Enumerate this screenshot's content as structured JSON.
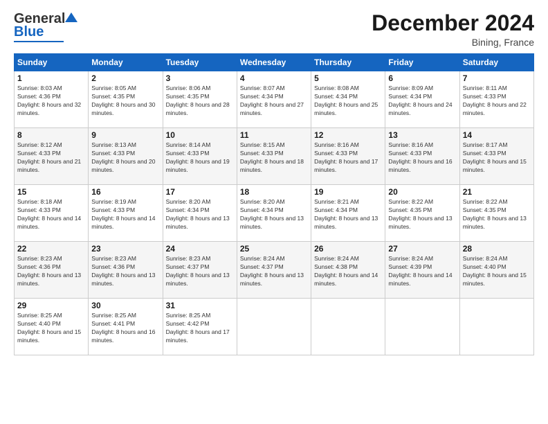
{
  "header": {
    "logo_general": "General",
    "logo_blue": "Blue",
    "title": "December 2024",
    "subtitle": "Bining, France"
  },
  "weekdays": [
    "Sunday",
    "Monday",
    "Tuesday",
    "Wednesday",
    "Thursday",
    "Friday",
    "Saturday"
  ],
  "weeks": [
    [
      {
        "day": "1",
        "sunrise": "8:03 AM",
        "sunset": "4:36 PM",
        "daylight": "8 hours and 32 minutes."
      },
      {
        "day": "2",
        "sunrise": "8:05 AM",
        "sunset": "4:35 PM",
        "daylight": "8 hours and 30 minutes."
      },
      {
        "day": "3",
        "sunrise": "8:06 AM",
        "sunset": "4:35 PM",
        "daylight": "8 hours and 28 minutes."
      },
      {
        "day": "4",
        "sunrise": "8:07 AM",
        "sunset": "4:34 PM",
        "daylight": "8 hours and 27 minutes."
      },
      {
        "day": "5",
        "sunrise": "8:08 AM",
        "sunset": "4:34 PM",
        "daylight": "8 hours and 25 minutes."
      },
      {
        "day": "6",
        "sunrise": "8:09 AM",
        "sunset": "4:34 PM",
        "daylight": "8 hours and 24 minutes."
      },
      {
        "day": "7",
        "sunrise": "8:11 AM",
        "sunset": "4:33 PM",
        "daylight": "8 hours and 22 minutes."
      }
    ],
    [
      {
        "day": "8",
        "sunrise": "8:12 AM",
        "sunset": "4:33 PM",
        "daylight": "8 hours and 21 minutes."
      },
      {
        "day": "9",
        "sunrise": "8:13 AM",
        "sunset": "4:33 PM",
        "daylight": "8 hours and 20 minutes."
      },
      {
        "day": "10",
        "sunrise": "8:14 AM",
        "sunset": "4:33 PM",
        "daylight": "8 hours and 19 minutes."
      },
      {
        "day": "11",
        "sunrise": "8:15 AM",
        "sunset": "4:33 PM",
        "daylight": "8 hours and 18 minutes."
      },
      {
        "day": "12",
        "sunrise": "8:16 AM",
        "sunset": "4:33 PM",
        "daylight": "8 hours and 17 minutes."
      },
      {
        "day": "13",
        "sunrise": "8:16 AM",
        "sunset": "4:33 PM",
        "daylight": "8 hours and 16 minutes."
      },
      {
        "day": "14",
        "sunrise": "8:17 AM",
        "sunset": "4:33 PM",
        "daylight": "8 hours and 15 minutes."
      }
    ],
    [
      {
        "day": "15",
        "sunrise": "8:18 AM",
        "sunset": "4:33 PM",
        "daylight": "8 hours and 14 minutes."
      },
      {
        "day": "16",
        "sunrise": "8:19 AM",
        "sunset": "4:33 PM",
        "daylight": "8 hours and 14 minutes."
      },
      {
        "day": "17",
        "sunrise": "8:20 AM",
        "sunset": "4:34 PM",
        "daylight": "8 hours and 13 minutes."
      },
      {
        "day": "18",
        "sunrise": "8:20 AM",
        "sunset": "4:34 PM",
        "daylight": "8 hours and 13 minutes."
      },
      {
        "day": "19",
        "sunrise": "8:21 AM",
        "sunset": "4:34 PM",
        "daylight": "8 hours and 13 minutes."
      },
      {
        "day": "20",
        "sunrise": "8:22 AM",
        "sunset": "4:35 PM",
        "daylight": "8 hours and 13 minutes."
      },
      {
        "day": "21",
        "sunrise": "8:22 AM",
        "sunset": "4:35 PM",
        "daylight": "8 hours and 13 minutes."
      }
    ],
    [
      {
        "day": "22",
        "sunrise": "8:23 AM",
        "sunset": "4:36 PM",
        "daylight": "8 hours and 13 minutes."
      },
      {
        "day": "23",
        "sunrise": "8:23 AM",
        "sunset": "4:36 PM",
        "daylight": "8 hours and 13 minutes."
      },
      {
        "day": "24",
        "sunrise": "8:23 AM",
        "sunset": "4:37 PM",
        "daylight": "8 hours and 13 minutes."
      },
      {
        "day": "25",
        "sunrise": "8:24 AM",
        "sunset": "4:37 PM",
        "daylight": "8 hours and 13 minutes."
      },
      {
        "day": "26",
        "sunrise": "8:24 AM",
        "sunset": "4:38 PM",
        "daylight": "8 hours and 14 minutes."
      },
      {
        "day": "27",
        "sunrise": "8:24 AM",
        "sunset": "4:39 PM",
        "daylight": "8 hours and 14 minutes."
      },
      {
        "day": "28",
        "sunrise": "8:24 AM",
        "sunset": "4:40 PM",
        "daylight": "8 hours and 15 minutes."
      }
    ],
    [
      {
        "day": "29",
        "sunrise": "8:25 AM",
        "sunset": "4:40 PM",
        "daylight": "8 hours and 15 minutes."
      },
      {
        "day": "30",
        "sunrise": "8:25 AM",
        "sunset": "4:41 PM",
        "daylight": "8 hours and 16 minutes."
      },
      {
        "day": "31",
        "sunrise": "8:25 AM",
        "sunset": "4:42 PM",
        "daylight": "8 hours and 17 minutes."
      },
      null,
      null,
      null,
      null
    ]
  ],
  "labels": {
    "sunrise": "Sunrise:",
    "sunset": "Sunset:",
    "daylight": "Daylight:"
  }
}
